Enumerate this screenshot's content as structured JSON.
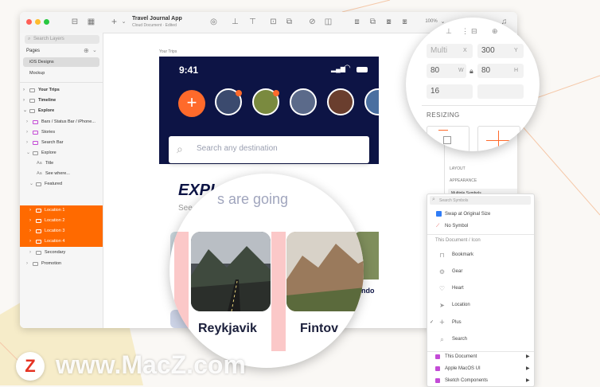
{
  "app": {
    "doc_title": "Travel Journal App",
    "doc_subtitle": "Cloud Document · Edited",
    "zoom": "100%"
  },
  "sidebar": {
    "search_placeholder": "Search Layers",
    "pages_label": "Pages",
    "pages": [
      {
        "label": "iOS Designs"
      },
      {
        "label": "Mockup"
      }
    ],
    "layers": [
      {
        "label": "Your Trips"
      },
      {
        "label": "Timeline"
      },
      {
        "label": "Explore"
      },
      {
        "label": "Bars / Status Bar / iPhone..."
      },
      {
        "label": "Stories"
      },
      {
        "label": "Search Bar"
      },
      {
        "label": "Explore"
      },
      {
        "label": "Title"
      },
      {
        "label": "See where..."
      },
      {
        "label": "Featured"
      },
      {
        "label": "Location 1"
      },
      {
        "label": "Location 2"
      },
      {
        "label": "Location 3"
      },
      {
        "label": "Location 4"
      },
      {
        "label": "Secondary"
      },
      {
        "label": "Promotion"
      }
    ]
  },
  "artboard": {
    "label": "Your Trips",
    "time": "9:41",
    "search_placeholder": "Search any destination",
    "heading_bold": "EXPL",
    "heading_rest": "s are going",
    "subheading": "See",
    "cards": [
      {
        "city": "Reykjavik"
      },
      {
        "city": "Fintov"
      }
    ],
    "partial_label": "ndo"
  },
  "inspector": {
    "x_value": "Multi",
    "x_label": "X",
    "y_value": "300",
    "y_label": "Y",
    "w_value": "80",
    "w_label": "W",
    "h_value": "80",
    "h_label": "H",
    "radius_value": "16",
    "resizing_label": "RESIZING",
    "layout_label": "LAYOUT",
    "appearance_label": "APPEARANCE",
    "symbol_value": "Multiple Symbols"
  },
  "symbol_panel": {
    "search_placeholder": "Search Symbols",
    "swap_label": "Swap at Original Size",
    "no_symbol": "No Symbol",
    "section_label": "This Document / Icon",
    "items": [
      {
        "label": "Bookmark",
        "icon": "bookmark-icon"
      },
      {
        "label": "Gear",
        "icon": "gear-icon"
      },
      {
        "label": "Heart",
        "icon": "heart-icon"
      },
      {
        "label": "Location",
        "icon": "location-icon"
      },
      {
        "label": "Plus",
        "icon": "plus-icon"
      },
      {
        "label": "Search",
        "icon": "search-icon"
      }
    ],
    "libraries": [
      {
        "label": "This Document"
      },
      {
        "label": "Apple MacOS UI"
      },
      {
        "label": "Sketch Components"
      }
    ]
  },
  "watermark": {
    "text": "www.MacZ.com",
    "logo_letter": "Z"
  },
  "colors": {
    "accent": "#ff6a00",
    "navy": "#0d1445"
  }
}
